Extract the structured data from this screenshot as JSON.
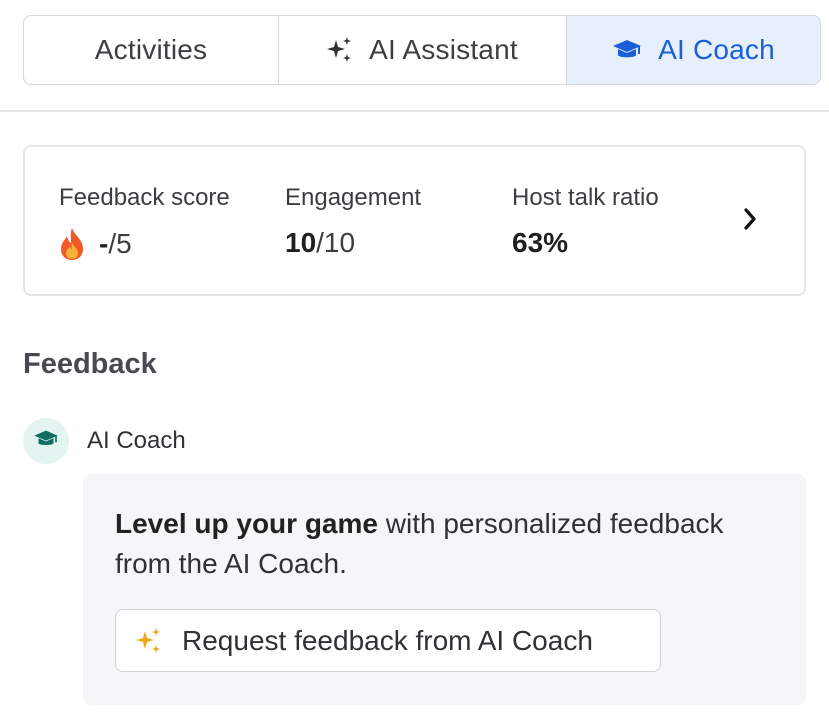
{
  "tabs": {
    "activities": {
      "label": "Activities"
    },
    "ai_assistant": {
      "label": "AI Assistant",
      "icon": "sparkles-icon"
    },
    "ai_coach": {
      "label": "AI Coach",
      "icon": "graduation-cap-icon",
      "active": true
    }
  },
  "stats": {
    "feedback_score": {
      "label": "Feedback score",
      "value": "-",
      "suffix": "/5",
      "icon": "fire-icon"
    },
    "engagement": {
      "label": "Engagement",
      "value": "10",
      "suffix": "/10"
    },
    "host_talk_ratio": {
      "label": "Host talk ratio",
      "value": "63%"
    },
    "more_icon": "chevron-right-icon"
  },
  "feedback": {
    "title": "Feedback",
    "author": "AI Coach",
    "author_icon": "graduation-cap-icon",
    "message_strong": "Level up your game",
    "message_rest": " with personalized feedback from the AI Coach.",
    "request_button": {
      "label": "Request feedback from AI Coach",
      "icon": "sparkles-icon"
    }
  },
  "colors": {
    "accent": "#1a5fd8",
    "active_tab_bg": "#e7effc",
    "coach_teal": "#0f6e62",
    "sparkle_gold": "#f0a51f",
    "panel_bg": "#f5f6f8"
  }
}
